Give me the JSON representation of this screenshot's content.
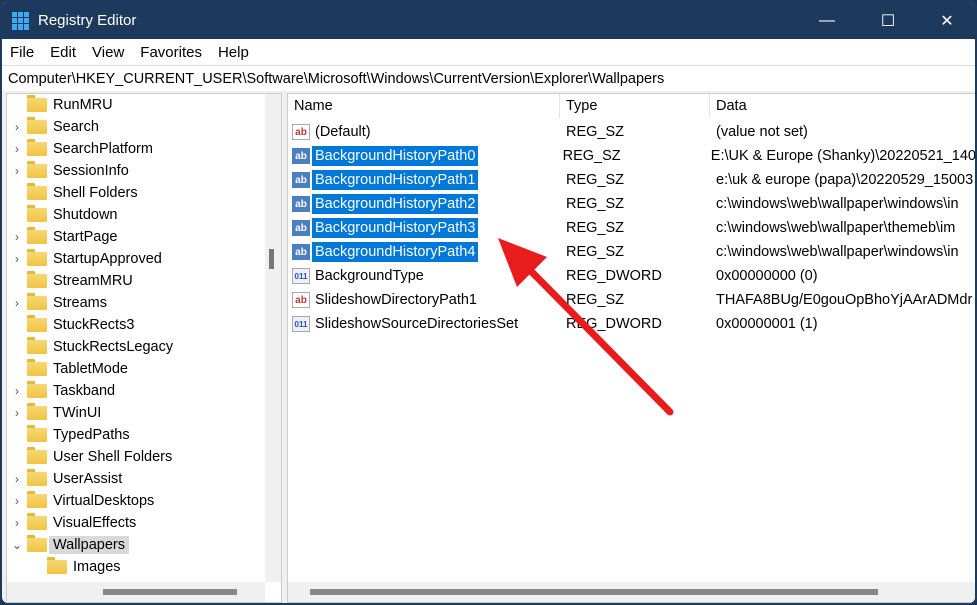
{
  "window": {
    "title": "Registry Editor",
    "minimize": "—",
    "maximize": "☐",
    "close": "✕"
  },
  "menu": [
    "File",
    "Edit",
    "View",
    "Favorites",
    "Help"
  ],
  "address": "Computer\\HKEY_CURRENT_USER\\Software\\Microsoft\\Windows\\CurrentVersion\\Explorer\\Wallpapers",
  "tree": [
    {
      "label": "RunMRU",
      "chev": ""
    },
    {
      "label": "Search",
      "chev": "›"
    },
    {
      "label": "SearchPlatform",
      "chev": "›"
    },
    {
      "label": "SessionInfo",
      "chev": "›"
    },
    {
      "label": "Shell Folders",
      "chev": ""
    },
    {
      "label": "Shutdown",
      "chev": ""
    },
    {
      "label": "StartPage",
      "chev": "›"
    },
    {
      "label": "StartupApproved",
      "chev": "›"
    },
    {
      "label": "StreamMRU",
      "chev": ""
    },
    {
      "label": "Streams",
      "chev": "›"
    },
    {
      "label": "StuckRects3",
      "chev": ""
    },
    {
      "label": "StuckRectsLegacy",
      "chev": ""
    },
    {
      "label": "TabletMode",
      "chev": ""
    },
    {
      "label": "Taskband",
      "chev": "›"
    },
    {
      "label": "TWinUI",
      "chev": "›"
    },
    {
      "label": "TypedPaths",
      "chev": ""
    },
    {
      "label": "User Shell Folders",
      "chev": ""
    },
    {
      "label": "UserAssist",
      "chev": "›"
    },
    {
      "label": "VirtualDesktops",
      "chev": "›"
    },
    {
      "label": "VisualEffects",
      "chev": "›"
    },
    {
      "label": "Wallpapers",
      "chev": "⌄"
    },
    {
      "label": "Images",
      "chev": ""
    }
  ],
  "columns": {
    "name": "Name",
    "type": "Type",
    "data": "Data"
  },
  "values": [
    {
      "name": "(Default)",
      "type": "REG_SZ",
      "data": "(value not set)",
      "icon": "ab",
      "selected": false
    },
    {
      "name": "BackgroundHistoryPath0",
      "type": "REG_SZ",
      "data": "E:\\UK & Europe (Shanky)\\20220521_140",
      "icon": "ab",
      "selected": true
    },
    {
      "name": "BackgroundHistoryPath1",
      "type": "REG_SZ",
      "data": "e:\\uk & europe (papa)\\20220529_15003",
      "icon": "ab",
      "selected": true
    },
    {
      "name": "BackgroundHistoryPath2",
      "type": "REG_SZ",
      "data": "c:\\windows\\web\\wallpaper\\windows\\in",
      "icon": "ab",
      "selected": true
    },
    {
      "name": "BackgroundHistoryPath3",
      "type": "REG_SZ",
      "data": "c:\\windows\\web\\wallpaper\\themeb\\im",
      "icon": "ab",
      "selected": true
    },
    {
      "name": "BackgroundHistoryPath4",
      "type": "REG_SZ",
      "data": "c:\\windows\\web\\wallpaper\\windows\\in",
      "icon": "ab",
      "selected": true
    },
    {
      "name": "BackgroundType",
      "type": "REG_DWORD",
      "data": "0x00000000 (0)",
      "icon": "011",
      "selected": false
    },
    {
      "name": "SlideshowDirectoryPath1",
      "type": "REG_SZ",
      "data": "THAFA8BUg/E0gouOpBhoYjAArADMdr",
      "icon": "ab",
      "selected": false
    },
    {
      "name": "SlideshowSourceDirectoriesSet",
      "type": "REG_DWORD",
      "data": "0x00000001 (1)",
      "icon": "011",
      "selected": false
    }
  ],
  "colors": {
    "titlebar": "#1d3a5c",
    "selection": "#0078d7",
    "arrow": "#e81c1c"
  }
}
